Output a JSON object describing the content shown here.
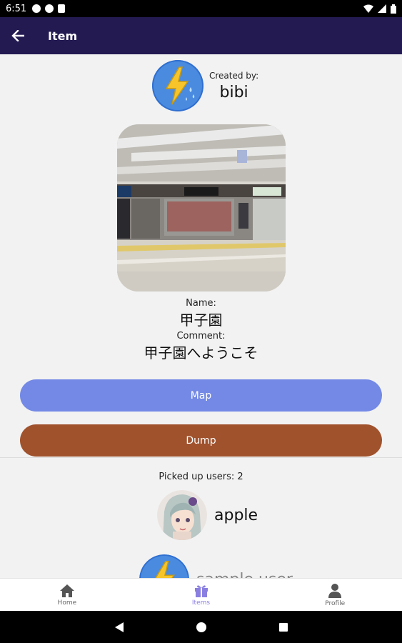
{
  "status_bar": {
    "time": "6:51",
    "icons": [
      "notification-icon",
      "notification-icon",
      "doc-icon"
    ],
    "right_icons": [
      "wifi-icon",
      "signal-icon",
      "battery-icon"
    ]
  },
  "app_bar": {
    "title": "Item",
    "back_icon": "arrow-back-icon",
    "background": "#231a52"
  },
  "creator": {
    "label": "Created by:",
    "name": "bibi",
    "avatar_icon": "lightning-bolt-icon"
  },
  "item": {
    "name_label": "Name:",
    "name": "甲子園",
    "comment_label": "Comment:",
    "comment": "甲子園へようこそ"
  },
  "buttons": {
    "map": "Map",
    "dump": "Dump",
    "map_color": "#7389e5",
    "dump_color": "#a0522d"
  },
  "picked": {
    "label": "Picked up users:",
    "count": "2",
    "users": [
      {
        "name": "apple",
        "avatar": "anime-girl-avatar"
      },
      {
        "name": "sample user",
        "avatar": "lightning-bolt-icon"
      }
    ]
  },
  "bottom_nav": [
    {
      "label": "Home",
      "icon": "home-icon",
      "active": false
    },
    {
      "label": "Items",
      "icon": "gift-icon",
      "active": true
    },
    {
      "label": "Profile",
      "icon": "person-icon",
      "active": false
    }
  ],
  "sys_nav": [
    "back-triangle-icon",
    "home-circle-icon",
    "recents-square-icon"
  ]
}
